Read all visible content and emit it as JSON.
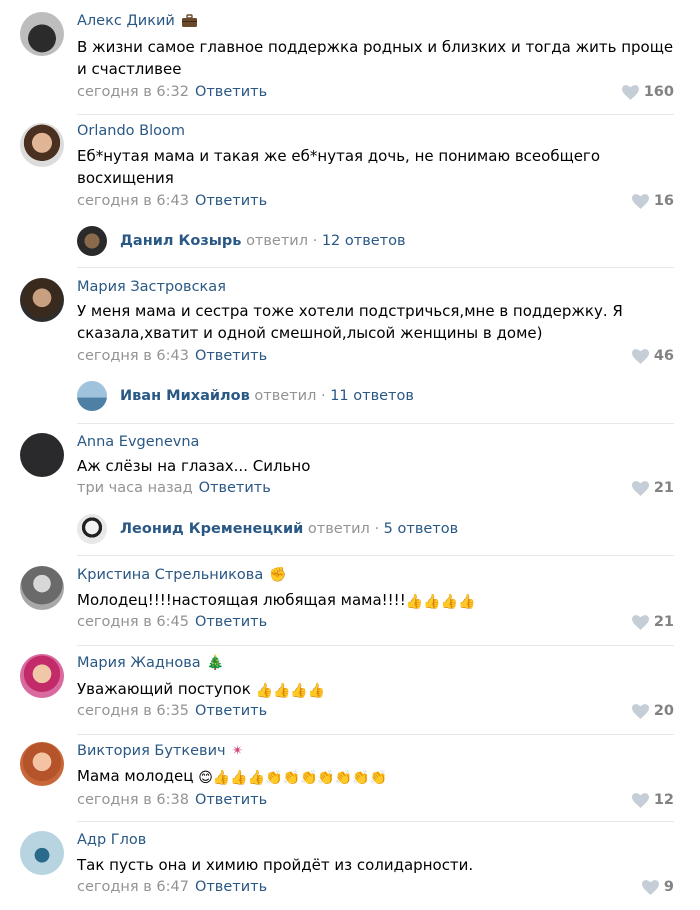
{
  "reply_label": "Ответить",
  "replied_label": "ответил",
  "comments": [
    {
      "author": "Алекс Дикий",
      "badge": "briefcase-icon",
      "text": "В жизни самое главное поддержка родных и близких и тогда жить проще и счастливее",
      "time": "сегодня в 6:32",
      "likes": "160"
    },
    {
      "author": "Orlando Bloom",
      "text": "Еб*нутая мама и такая же еб*нутая дочь, не понимаю всеобщего восхищения",
      "time": "сегодня в 6:43",
      "likes": "16",
      "thread": {
        "name": "Данил Козырь",
        "count": "12 ответов"
      }
    },
    {
      "author": "Мария Застровская",
      "text": "У меня мама и сестра тоже хотели подстричься,мне в поддержку. Я сказала,хватит и одной смешной,лысой женщины в доме)",
      "time": "сегодня в 6:43",
      "likes": "46",
      "thread": {
        "name": "Иван Михайлов",
        "count": "11 ответов"
      }
    },
    {
      "author": "Anna Evgenevna",
      "text": "Аж слёзы на глазах... Сильно",
      "time": "три часа назад",
      "likes": "21",
      "thread": {
        "name": "Леонид Кременецкий",
        "count": "5 ответов"
      }
    },
    {
      "author": "Кристина Стрельникова",
      "badge": "fist-emoji",
      "text": "Молодец!!!!настоящая любящая мама!!!!",
      "emoji_tail": "👍👍👍👍",
      "time": "сегодня в 6:45",
      "likes": "21"
    },
    {
      "author": "Мария Жаднова",
      "badge": "christmas-tree-emoji",
      "text": "Уважающий поступок ",
      "emoji_tail": "👍👍👍👍",
      "time": "сегодня в 6:35",
      "likes": "20"
    },
    {
      "author": "Виктория Буткевич",
      "badge": "sparkle-emoji",
      "text": "Мама молодец ",
      "emoji_tail": "😊👍👍👍👏👏👏👏👏👏👏",
      "time": "сегодня в 6:38",
      "likes": "12"
    },
    {
      "author": "Адр Глов",
      "text": "Так пусть она и химию пройдёт из солидарности.",
      "time": "сегодня в 6:47",
      "likes": "9"
    }
  ]
}
